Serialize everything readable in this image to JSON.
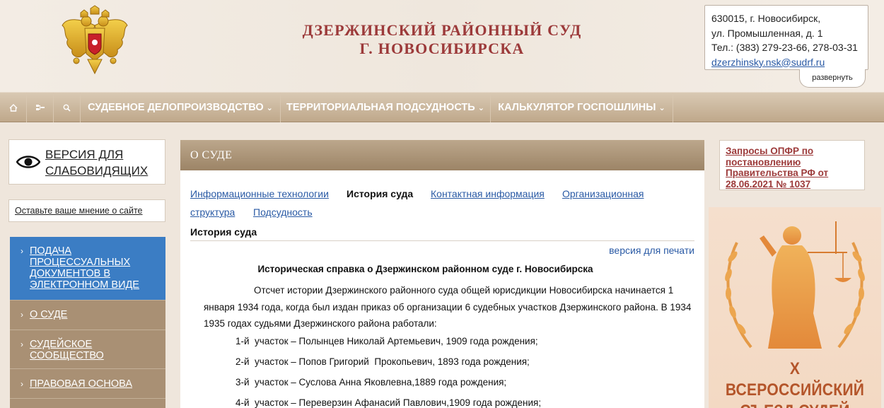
{
  "header": {
    "court_title_line1": "ДЗЕРЖИНСКИЙ РАЙОННЫЙ СУД",
    "court_title_line2": "Г. НОВОСИБИРСКА",
    "contact": {
      "address1": "630015, г. Новосибирск,",
      "address2": "ул. Промышленная, д. 1",
      "phone": "Тел.: (383) 279-23-66, 278-03-31",
      "email": "dzerzhinsky.nsk@sudrf.ru",
      "expand_label": "развернуть"
    }
  },
  "nav": {
    "items": [
      {
        "label": "СУДЕБНОЕ ДЕЛОПРОИЗВОДСТВО"
      },
      {
        "label": "ТЕРРИТОРИАЛЬНАЯ ПОДСУДНОСТЬ"
      },
      {
        "label": "КАЛЬКУЛЯТОР ГОСПОШЛИНЫ"
      }
    ],
    "chevron": "⌄"
  },
  "left": {
    "vision_line1": "ВЕРСИЯ ДЛЯ",
    "vision_line2": "СЛАБОВИДЯЩИХ",
    "opinion": "Оставьте ваше мнение о сайте",
    "menu": [
      {
        "lines": [
          "ПОДАЧА",
          "ПРОЦЕССУАЛЬНЫХ",
          "ДОКУМЕНТОВ В",
          "ЭЛЕКТРОННОМ ВИДЕ"
        ]
      },
      {
        "lines": [
          "О СУДЕ"
        ]
      },
      {
        "lines": [
          "СУДЕЙСКОЕ",
          "СООБЩЕСТВО"
        ]
      },
      {
        "lines": [
          "ПРАВОВАЯ ОСНОВА"
        ]
      }
    ],
    "arrow": "›"
  },
  "main": {
    "heading": "О СУДЕ",
    "tabs": [
      {
        "label": "Информационные технологии"
      },
      {
        "label": "История суда"
      },
      {
        "label": "Контактная информация"
      },
      {
        "label": "Организационная"
      },
      {
        "label": "структура"
      },
      {
        "label": "Подсудность"
      }
    ],
    "section_title": "История суда",
    "print_version": "версия для печати",
    "doc_title": "Историческая справка о Дзержинском районном суде г. Новосибирска",
    "para_line1": "Отсчет истории Дзержинского районного суда общей юрисдикции Новосибирска начинается 1",
    "para_line2": "января 1934 года, когда был издан приказ об организации 6 судебных участков Дзержинского района.  В 1934",
    "para_line3": "1935 годах  судьями Дзержинского района работали:",
    "judges": [
      "1-й  участок – Полынцев Николай Артемьевич, 1909 года рождения;",
      "2-й  участок – Попов Григорий  Прокопьевич, 1893 года рождения;",
      "3-й  участок – Суслова Анна Яковлевна,1889 года рождения;",
      "4-й  участок – Переверзин Афанасий Павлович,1909 года рождения;"
    ]
  },
  "right": {
    "link_text": "Запросы ОПФР по постановлению Правительства РФ от 28.06.2021 № 1037",
    "banner_line1": "X ВСЕРОССИЙСКИЙ",
    "banner_line2": "СЪЕЗД СУДЕЙ"
  },
  "colors": {
    "accent": "#9c3a3a",
    "nav_bg": "#c7b093",
    "link": "#2a5aa5",
    "menu_active": "#3b7dc4",
    "menu_bg": "#a99074",
    "banner_text": "#b4552a"
  }
}
